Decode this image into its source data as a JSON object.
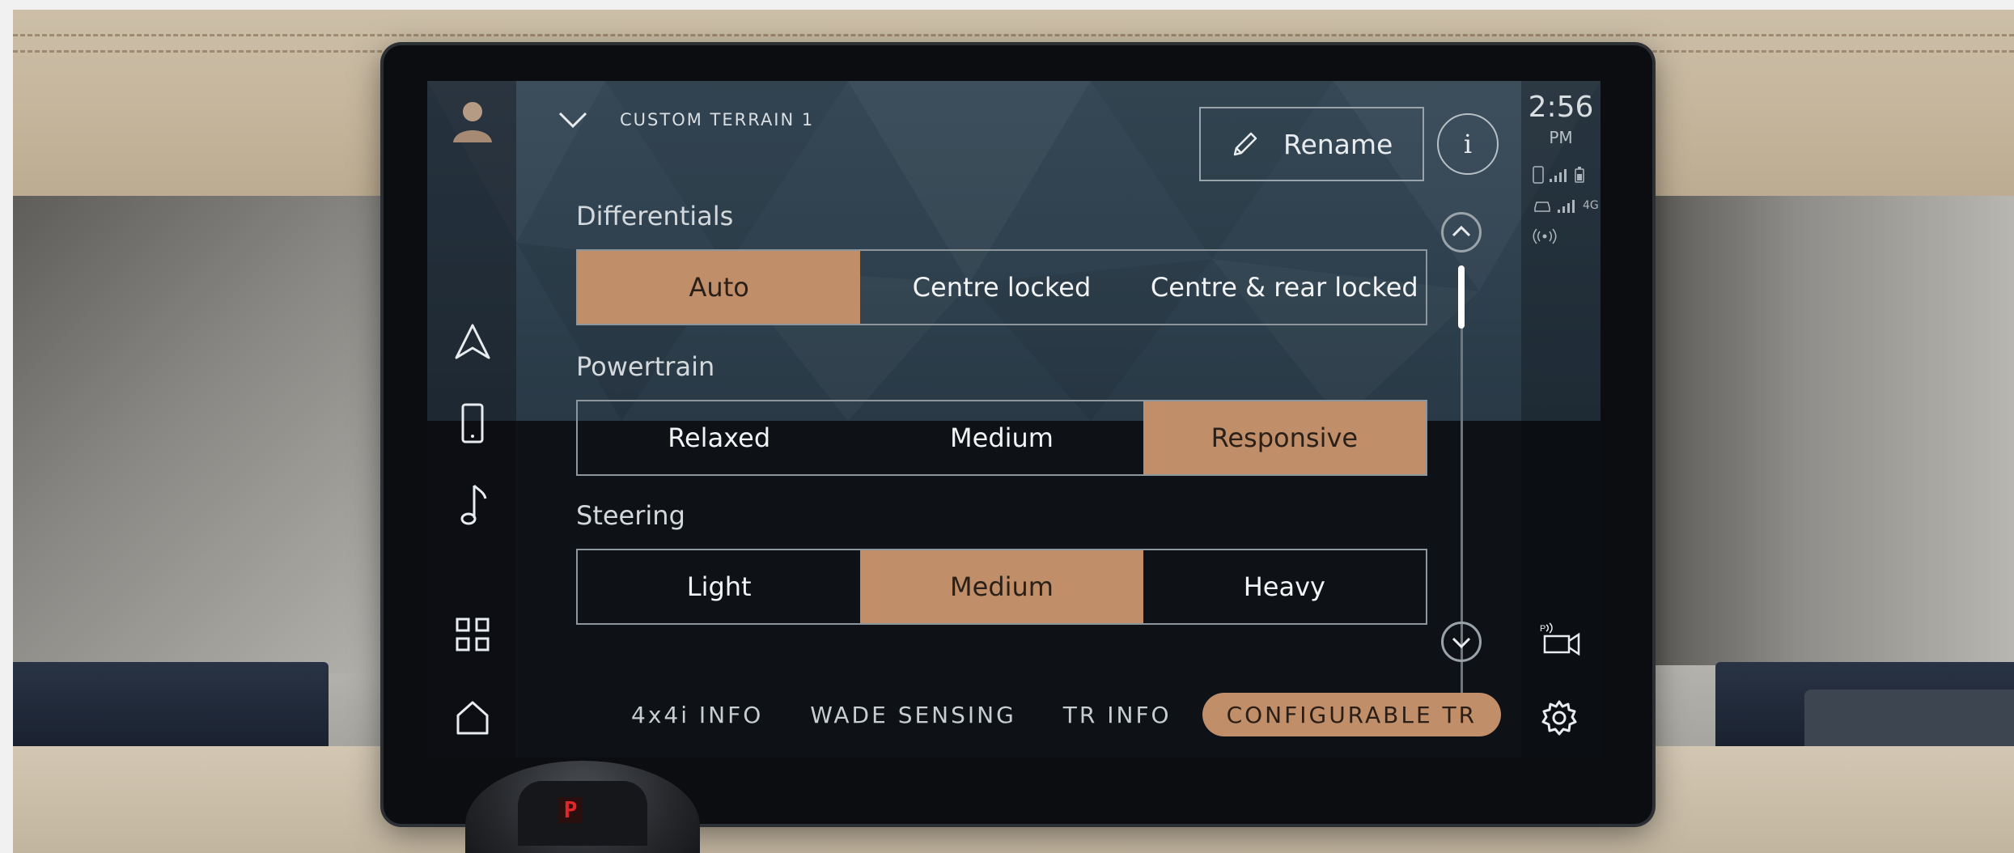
{
  "header": {
    "menu_title": "CUSTOM TERRAIN 1",
    "rename_label": "Rename",
    "info_label": "i"
  },
  "status": {
    "time": "2:56",
    "ampm": "PM",
    "network_label": "4G"
  },
  "sections": [
    {
      "label": "Differentials",
      "options": [
        "Auto",
        "Centre locked",
        "Centre & rear locked"
      ],
      "selected": 0
    },
    {
      "label": "Powertrain",
      "options": [
        "Relaxed",
        "Medium",
        "Responsive"
      ],
      "selected": 2
    },
    {
      "label": "Steering",
      "options": [
        "Light",
        "Medium",
        "Heavy"
      ],
      "selected": 1
    }
  ],
  "tabs": [
    {
      "label": "4x4i INFO",
      "selected": false
    },
    {
      "label": "WADE SENSING",
      "selected": false
    },
    {
      "label": "TR INFO",
      "selected": false
    },
    {
      "label": "CONFIGURABLE TR",
      "selected": true
    }
  ],
  "scroll": {
    "position": 0.0
  },
  "gear_indicator": "P",
  "colors": {
    "accent": "#c08e69",
    "text": "#f1f3f4",
    "screen_bg": "#0e1116"
  },
  "left_nav_icons": [
    "profile-icon",
    "navigation-icon",
    "phone-icon",
    "media-icon",
    "apps-grid-icon",
    "home-icon"
  ],
  "right_icons": [
    "parking-camera-icon",
    "settings-icon"
  ]
}
